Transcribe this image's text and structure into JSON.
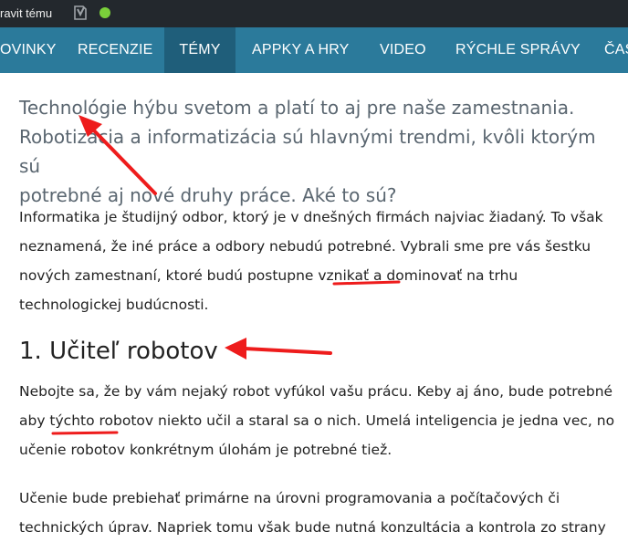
{
  "adminbar": {
    "edit_label": "ravit tému",
    "status_color": "#7ad03a",
    "icons": [
      "yoast-icon",
      "status-dot-icon"
    ]
  },
  "nav": {
    "items": [
      {
        "label": "OVINKY"
      },
      {
        "label": "RECENZIE"
      },
      {
        "label": "TÉMY",
        "active": true
      },
      {
        "label": "APPKY A HRY"
      },
      {
        "label": "VIDEO"
      },
      {
        "label": "RÝCHLE SPRÁVY"
      },
      {
        "label": "ČAS"
      }
    ],
    "background": "#2b7a9b",
    "active_background": "#1f5e7a"
  },
  "article": {
    "lead": [
      "Technológie hýbu svetom a platí to aj pre naše zamestnania.",
      "Robotizácia a informatizácia sú hlavnými trendmi, kvôli ktorým sú",
      "potrebné aj nové druhy práce. Aké to sú?"
    ],
    "intro": [
      "Informatika je študijný odbor, ktorý je v dnešných firmách najviac žiadaný. To však",
      "neznamená, že iné práce a odbory nebudú potrebné. Vybrali sme pre vás šestku",
      "nových zamestnaní, ktoré budú postupne vznikať a dominovať na trhu",
      "technologickej budúcnosti."
    ],
    "heading": "1. Učiteľ robotov",
    "para1": [
      "Nebojte sa, že by vám nejaký robot vyfúkol vašu prácu. Keby aj áno, bude potrebné",
      "aby týchto robotov niekto učil a staral sa o nich. Umelá inteligencia je jedna vec, no",
      "učenie robotov konkrétnym úlohám je potrebné tiež."
    ],
    "para2": [
      "Učenie bude prebiehať primárne na úrovni programovania a počítačových či",
      "technických úprav. Napriek tomu však bude nutná konzultácia a kontrola zo strany"
    ]
  },
  "annotations": {
    "color": "#ee1c1c"
  }
}
